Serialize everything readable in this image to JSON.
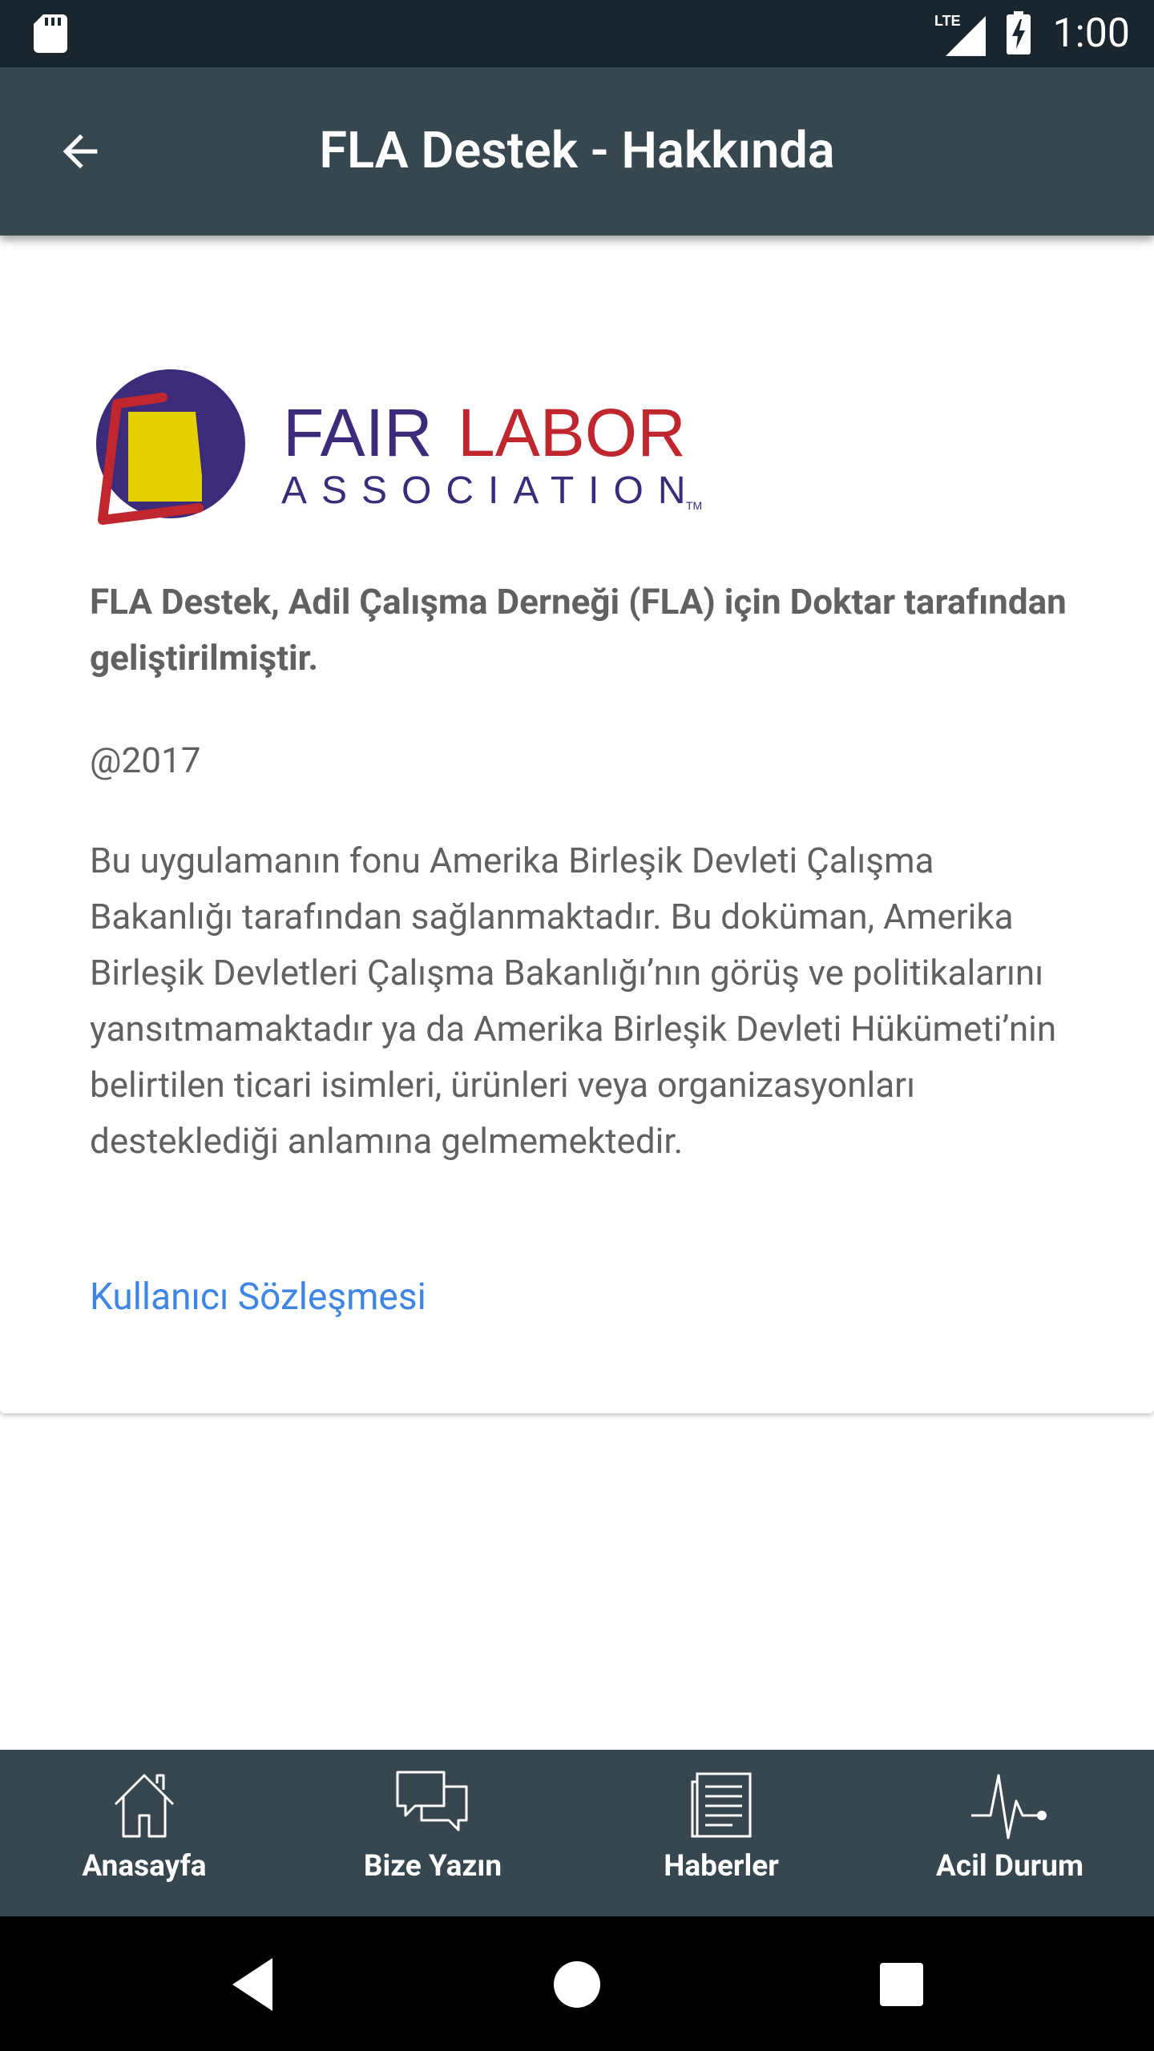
{
  "status_bar": {
    "network": "LTE",
    "time": "1:00"
  },
  "app_bar": {
    "title": "FLA Destek - Hakkında",
    "back_icon": "arrow-left-icon"
  },
  "about": {
    "logo": {
      "word1": "FAIR",
      "word2": "LABOR",
      "word3": "ASSOCIATION",
      "trademark": "TM"
    },
    "lead_text": "FLA Destek, Adil Çalışma Derneği (FLA) için Doktar tarafından geliştirilmiştir.",
    "year": "@2017",
    "disclaimer": "Bu uygulamanın fonu Amerika Birleşik Devleti Çalışma Bakanlığı tarafından sağlanmaktadır. Bu doküman, Amerika Birleşik Devletleri Çalışma Bakanlığı’nın görüş ve politikalarını yansıtmamaktadır ya da Amerika Birleşik Devleti Hükümeti’nin belirtilen ticari isimleri, ürünleri veya organizasyonları desteklediği anlamına gelmemektedir.",
    "terms_link": "Kullanıcı Sözleşmesi"
  },
  "bottom_nav": {
    "items": [
      {
        "label": "Anasayfa",
        "icon": "home-icon"
      },
      {
        "label": "Bize Yazın",
        "icon": "chat-bubbles-icon"
      },
      {
        "label": "Haberler",
        "icon": "news-icon"
      },
      {
        "label": "Acil Durum",
        "icon": "heartbeat-icon"
      }
    ]
  },
  "colors": {
    "status_bar": "#19262d",
    "app_bar": "#37474f",
    "bottom_nav": "#37474f",
    "body_text": "#616161",
    "link": "#3f86e4",
    "logo_purple": "#3c2a7a",
    "logo_red": "#c0262d",
    "logo_yellow": "#e3d000"
  }
}
